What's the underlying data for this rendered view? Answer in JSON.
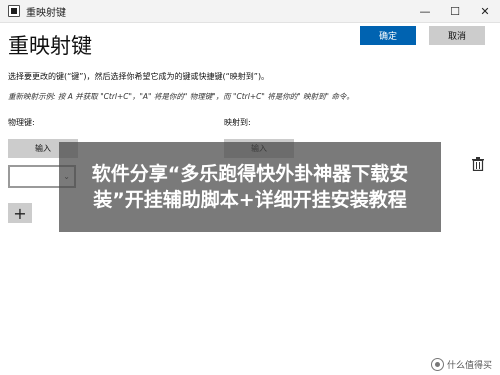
{
  "window": {
    "title": "重映射键",
    "controls": {
      "minimize": "—",
      "maximize": "☐",
      "close": "✕"
    }
  },
  "header": {
    "title": "重映射键",
    "ok_label": "确定",
    "cancel_label": "取消"
  },
  "instructions": {
    "main": "选择要更改的键(“键”)，然后选择你希望它成为的键或快捷键(“映射到”)。",
    "example": "重新映射示例: 按 A 并获取 \"Ctrl+C\"，\"A\" 将是你的\" 物理键\"，而 \"Ctrl+C\" 将是你的\" 映射到\" 命令。"
  },
  "columns": {
    "physical_label": "物理键:",
    "mapped_label": "映射到:"
  },
  "row": {
    "physical_type_button": "输入",
    "mapped_type_button": "输入",
    "dropdown_value": "",
    "dropdown_chevron": "⌄"
  },
  "actions": {
    "add_symbol": "+"
  },
  "overlay": {
    "text": "软件分享“多乐跑得快外卦神器下载安装”开挂辅助脚本+详细开挂安装教程"
  },
  "watermark": {
    "text": "什么值得买"
  }
}
